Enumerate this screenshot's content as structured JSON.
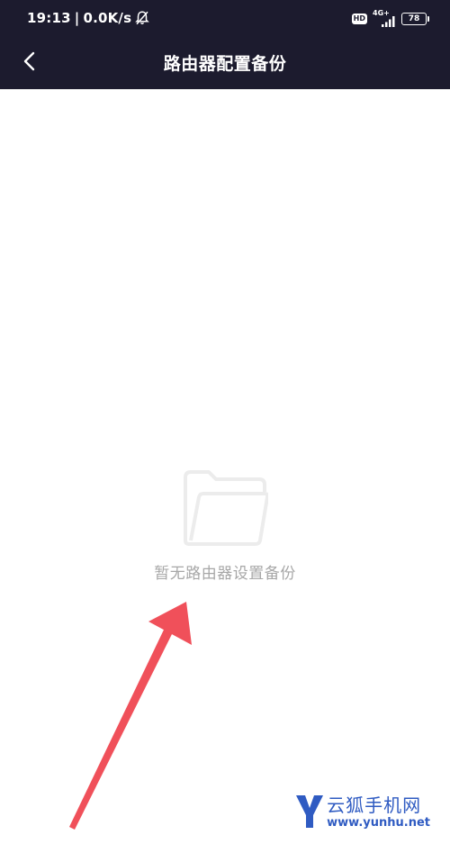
{
  "status_bar": {
    "time": "19:13",
    "separator": "|",
    "net_speed": "0.0K/s",
    "hd_badge": "HD",
    "network_type": "4G+",
    "battery_level": "78"
  },
  "nav": {
    "title": "路由器配置备份",
    "back_icon": "chevron-left-icon"
  },
  "empty_state": {
    "icon": "folder-icon",
    "message": "暂无路由器设置备份"
  },
  "watermark": {
    "name": "云狐手机网",
    "url": "www.yunhu.net",
    "logo_letter": "Y"
  },
  "colors": {
    "header_bg": "#1c1b2e",
    "empty_text": "#a7a7a7",
    "folder_stroke": "#ececec",
    "arrow": "#f0505a",
    "watermark": "#2f5bc2"
  }
}
